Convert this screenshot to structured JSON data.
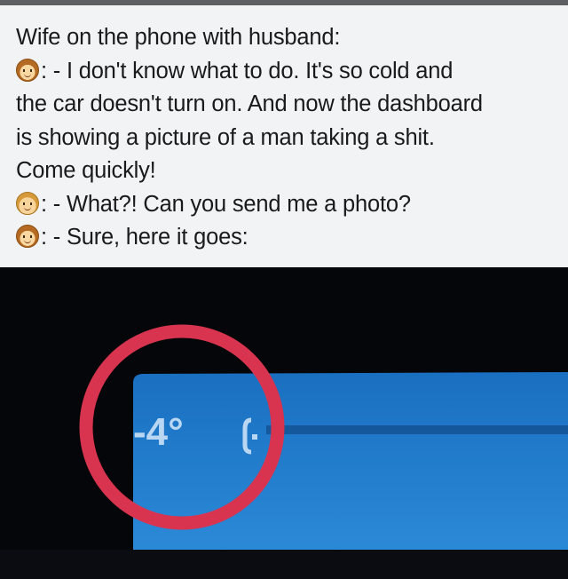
{
  "post": {
    "lines": [
      {
        "speaker": "",
        "text": "Wife on the phone with husband:"
      },
      {
        "speaker": "wife",
        "text": ": - I don't know what to do. It's so cold and"
      },
      {
        "speaker": "",
        "text": "the car doesn't turn on. And now the dashboard"
      },
      {
        "speaker": "",
        "text": "is showing a picture of a man taking a shit."
      },
      {
        "speaker": "",
        "text": "Come quickly!"
      },
      {
        "speaker": "husband",
        "text": ": - What?! Can you send me a photo?"
      },
      {
        "speaker": "wife",
        "text": ": - Sure, here it goes:"
      }
    ]
  },
  "photo": {
    "temperature": "-4°",
    "colors": {
      "background": "#050609",
      "display_blue": "#1f78c8",
      "highlight_circle": "#d8344f",
      "digit_color": "#b9d6f2"
    }
  },
  "icons": {
    "wife": "woman-face-emoji-icon",
    "husband": "man-face-emoji-icon",
    "dashboard_symbol": "car-battery-symbol-icon"
  }
}
